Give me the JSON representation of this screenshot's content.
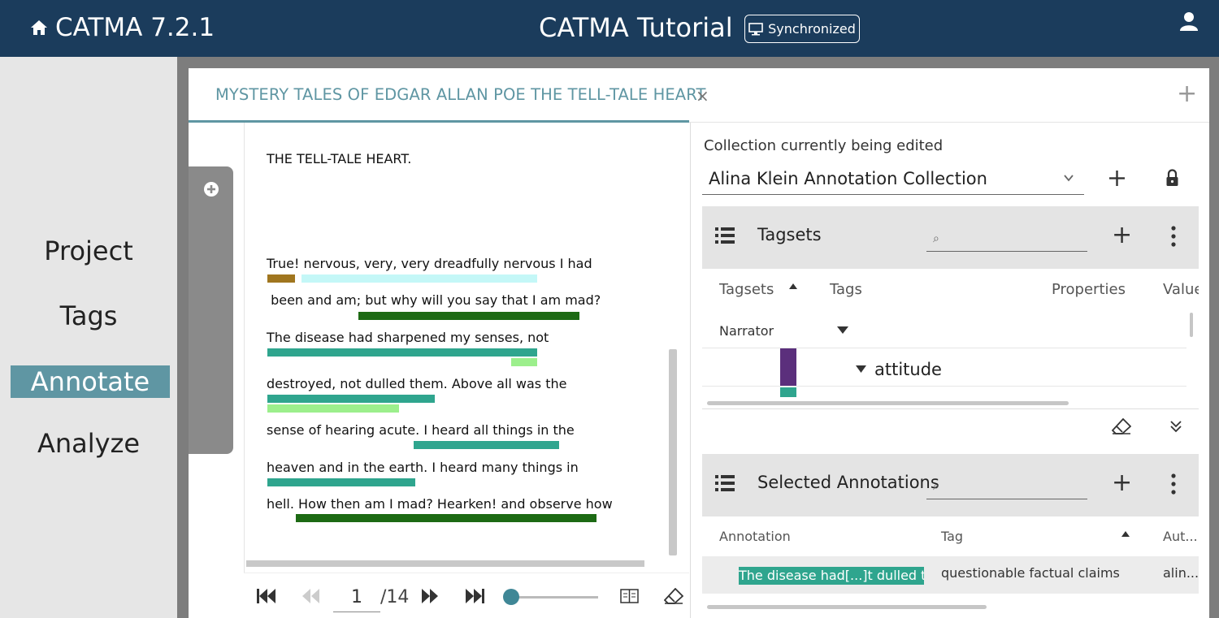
{
  "app": {
    "brand": "CATMA 7.2.1",
    "project_title": "CATMA Tutorial",
    "sync_label": "Synchronized"
  },
  "nav": {
    "items": [
      {
        "label": "Project",
        "active": false
      },
      {
        "label": "Tags",
        "active": false
      },
      {
        "label": "Annotate",
        "active": true
      },
      {
        "label": "Analyze",
        "active": false
      }
    ]
  },
  "tabs": {
    "doc_title": "MYSTERY TALES OF EDGAR ALLAN POE THE TELL-TALE HEART",
    "close_symbol": "×",
    "add_symbol": "+"
  },
  "document": {
    "lines": [
      "THE TELL-TALE HEART.",
      "True! nervous, very, very dreadfully nervous I had",
      " been and am; but why will you say that I am mad?",
      "The disease had sharpened my senses, not",
      "destroyed, not dulled them. Above all was the",
      "sense of hearing acute. I heard all things in the",
      "heaven and in the earth. I heard many things in",
      "hell. How then am I mad? Hearken! and observe how"
    ],
    "highlight_colors": {
      "brown": "#a0761f",
      "light_cyan": "#c4f7f7",
      "dark_green": "#1d6a14",
      "teal": "#2fa58e",
      "light_green": "#9cef8c"
    }
  },
  "pager": {
    "current_page": "1",
    "total_pages": "/14"
  },
  "right_panel": {
    "collection_label": "Collection currently being edited",
    "collection_value": "Alina Klein Annotation Collection",
    "tagsets": {
      "title": "Tagsets",
      "columns": [
        "Tagsets",
        "Tags",
        "Properties",
        "Value"
      ],
      "rows": [
        {
          "tagset": "Narrator"
        },
        {
          "tag": "attitude",
          "color": "#5b2f7c"
        }
      ]
    },
    "selected_annotations": {
      "title": "Selected Annotations",
      "columns": [
        "Annotation",
        "Tag",
        "Aut..."
      ],
      "rows": [
        {
          "annotation": "The disease had[...]t dulled them",
          "tag": "questionable factual claims",
          "author": "alin..."
        }
      ]
    }
  }
}
